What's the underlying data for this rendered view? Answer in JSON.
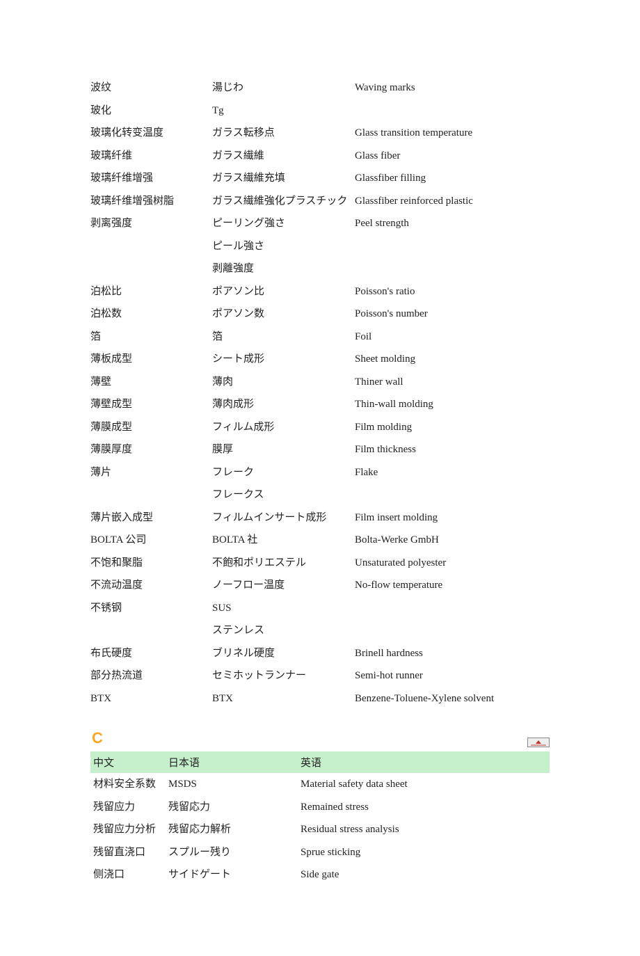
{
  "section_b_rows": [
    {
      "cn": "波纹",
      "jp": "湯じわ",
      "en": "Waving marks"
    },
    {
      "cn": "玻化",
      "jp": "Tg",
      "en": ""
    },
    {
      "cn": "玻璃化转变温度",
      "jp": "ガラス転移点",
      "en": "Glass transition temperature"
    },
    {
      "cn": "玻璃纤维",
      "jp": "ガラス繊維",
      "en": "Glass fiber"
    },
    {
      "cn": "玻璃纤维增强",
      "jp": "ガラス繊維充填",
      "en": "Glassfiber filling"
    },
    {
      "cn": "玻璃纤维增强树脂",
      "jp": "ガラス繊維強化プラスチック",
      "en": "Glassfiber reinforced plastic"
    },
    {
      "cn": "剥离强度",
      "jp": "ピーリング強さ",
      "en": "Peel strength"
    },
    {
      "cn": "",
      "jp": "ピール強さ",
      "en": ""
    },
    {
      "cn": "",
      "jp": "剥離強度",
      "en": ""
    },
    {
      "cn": "泊松比",
      "jp": "ポアソン比",
      "en": "Poisson's ratio"
    },
    {
      "cn": "泊松数",
      "jp": "ポアソン数",
      "en": "Poisson's number"
    },
    {
      "cn": "箔",
      "jp": "箔",
      "en": "Foil"
    },
    {
      "cn": "薄板成型",
      "jp": "シート成形",
      "en": "Sheet molding"
    },
    {
      "cn": "薄壁",
      "jp": "薄肉",
      "en": "Thiner wall"
    },
    {
      "cn": "薄壁成型",
      "jp": "薄肉成形",
      "en": "Thin-wall molding"
    },
    {
      "cn": "薄膜成型",
      "jp": "フィルム成形",
      "en": "Film molding"
    },
    {
      "cn": "薄膜厚度",
      "jp": "膜厚",
      "en": "Film thickness"
    },
    {
      "cn": "薄片",
      "jp": "フレーク",
      "en": "Flake"
    },
    {
      "cn": "",
      "jp": "フレークス",
      "en": ""
    },
    {
      "cn": "薄片嵌入成型",
      "jp": "フィルムインサート成形",
      "en": "Film insert molding"
    },
    {
      "cn": "BOLTA 公司",
      "jp": "BOLTA 社",
      "en": "Bolta-Werke GmbH"
    },
    {
      "cn": "不饱和聚脂",
      "jp": "不飽和ポリエステル",
      "en": "Unsaturated polyester"
    },
    {
      "cn": "不流动温度",
      "jp": "ノーフロー温度",
      "en": "No-flow temperature"
    },
    {
      "cn": "不锈钢",
      "jp": "SUS",
      "en": ""
    },
    {
      "cn": "",
      "jp": "ステンレス",
      "en": ""
    },
    {
      "cn": "布氏硬度",
      "jp": "ブリネル硬度",
      "en": "Brinell hardness"
    },
    {
      "cn": "部分热流道",
      "jp": "セミホットランナー",
      "en": "Semi-hot runner"
    },
    {
      "cn": "BTX",
      "jp": "BTX",
      "en": "Benzene-Toluene-Xylene solvent"
    }
  ],
  "section_c": {
    "letter": "C",
    "headers": {
      "cn": "中文",
      "jp": "日本语",
      "en": "英语"
    },
    "rows": [
      {
        "cn": "材料安全系数",
        "jp": "MSDS",
        "en": "Material safety data sheet"
      },
      {
        "cn": "残留应力",
        "jp": "残留応力",
        "en": "Remained stress"
      },
      {
        "cn": "残留应力分析",
        "jp": "残留応力解析",
        "en": "Residual stress analysis"
      },
      {
        "cn": "残留直浇口",
        "jp": "スプルー残り",
        "en": "Sprue sticking"
      },
      {
        "cn": "侧浇口",
        "jp": "サイドゲート",
        "en": "Side gate"
      }
    ]
  }
}
